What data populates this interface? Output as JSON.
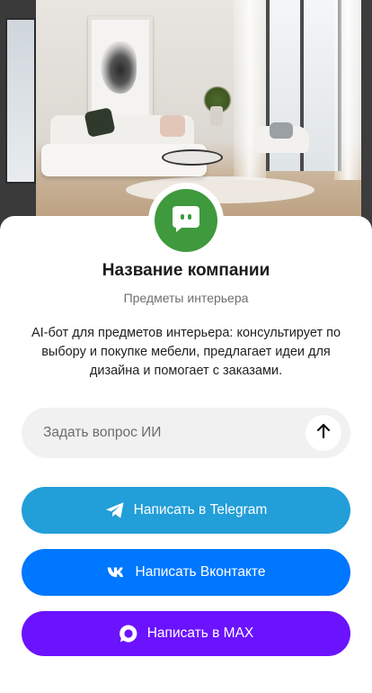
{
  "hero": {
    "image": "interior-living-room-photo"
  },
  "company": {
    "name": "Название компании",
    "category": "Предметы интерьера",
    "description": "AI-бот для предметов интерьера: консультирует по выбору и покупке мебели, предлагает идеи для дизайна и помогает с заказами.",
    "avatar_icon": "chat-bot-icon",
    "avatar_color": "#3e9a3c"
  },
  "ask": {
    "placeholder": "Задать вопрос ИИ",
    "value": "",
    "send_icon": "arrow-up-icon"
  },
  "buttons": [
    {
      "label": "Написать в Telegram",
      "icon": "telegram-icon",
      "color": "#229ed9"
    },
    {
      "label": "Написать Вконтакте",
      "icon": "vk-icon",
      "color": "#0077ff"
    },
    {
      "label": "Написать в MAX",
      "icon": "max-icon",
      "color": "#6b12ff"
    }
  ]
}
